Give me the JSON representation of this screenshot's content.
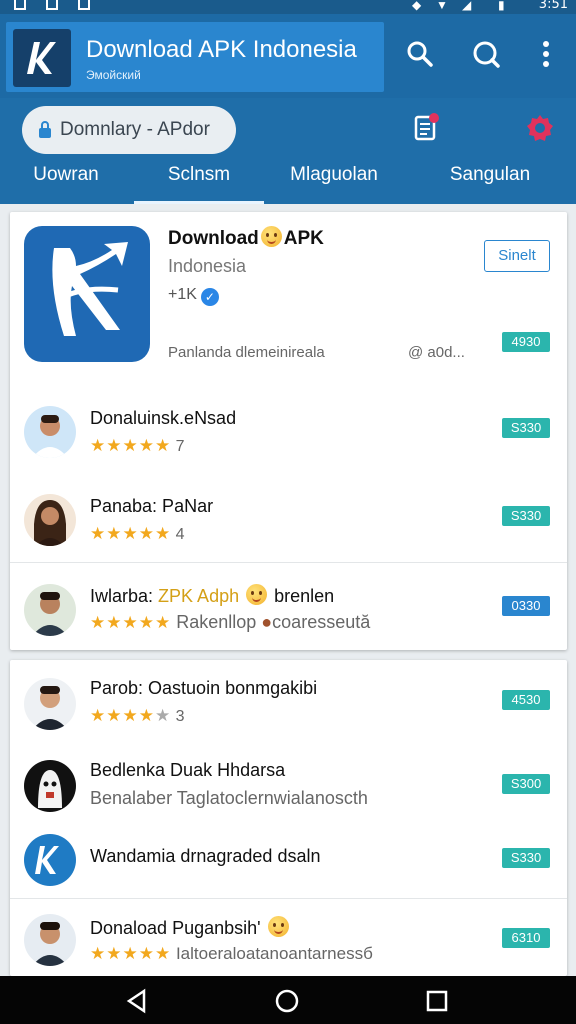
{
  "status_bar": {
    "time": "3:51"
  },
  "app_bar": {
    "title": "Download APK Indonesia",
    "subtitle": "Эмойский"
  },
  "toolbar": {
    "search_text": "Domnlary - APdor",
    "tabs": [
      {
        "label": "Uowran",
        "active": false
      },
      {
        "label": "Sclnsm",
        "active": true
      },
      {
        "label": "Mlaguolan",
        "active": false
      },
      {
        "label": "Sangulan",
        "active": false
      }
    ]
  },
  "featured": {
    "title_part1": "Download",
    "title_part2": "APK",
    "subtitle": "Indonesia",
    "count": "+1K",
    "description": "Panlanda dlemeinirealа",
    "meta": "@ a0d...",
    "open_label": "Sinelt",
    "badge": "4930",
    "icon": "apk-logo-icon"
  },
  "list_card1": [
    {
      "name": "Donaluinsk.eNsad",
      "stars": "★★★★★",
      "rating": "7",
      "badge": "S330",
      "badge_color": "#2bb5ad"
    },
    {
      "name": "Panaba: PaNar",
      "stars": "★★★★★",
      "rating": "4",
      "badge": "S330",
      "badge_color": "#2bb5ad"
    },
    {
      "name_part1": "Iwlarba:",
      "name_part2": "ZPK Adph",
      "name_part3": "brenlen",
      "stars": "★★★★★",
      "extra": "Rakenllop",
      "extra2": "coaresseută",
      "badge": "0330",
      "badge_color": "#2a86cf"
    }
  ],
  "list_card2": [
    {
      "name": "Parob: Oastuoin bonmgakibi",
      "stars": "★★★★",
      "rating": "3",
      "badge": "4530",
      "badge_color": "#2bb5ad"
    },
    {
      "name": "Bedlenka Duak Hhdarsa",
      "subtitle": "Benalaber Taglatoclernwialanoscth",
      "badge": "S300",
      "badge_color": "#2bb5ad"
    },
    {
      "name": "Wandamia drnagraded dsaln",
      "badge": "S330",
      "badge_color": "#2bb5ad"
    },
    {
      "name": "Donaload Puganbsih'",
      "stars": "★★★★★",
      "subtitle": "Ialtoeraloatanoantarnessб",
      "badge": "6310",
      "badge_color": "#2bb5ad"
    }
  ],
  "colors": {
    "primary": "#1d6aa5",
    "accent": "#2a86cf",
    "badge_teal": "#2bb5ad",
    "star": "#f2a81e",
    "gear": "#e0325c"
  }
}
